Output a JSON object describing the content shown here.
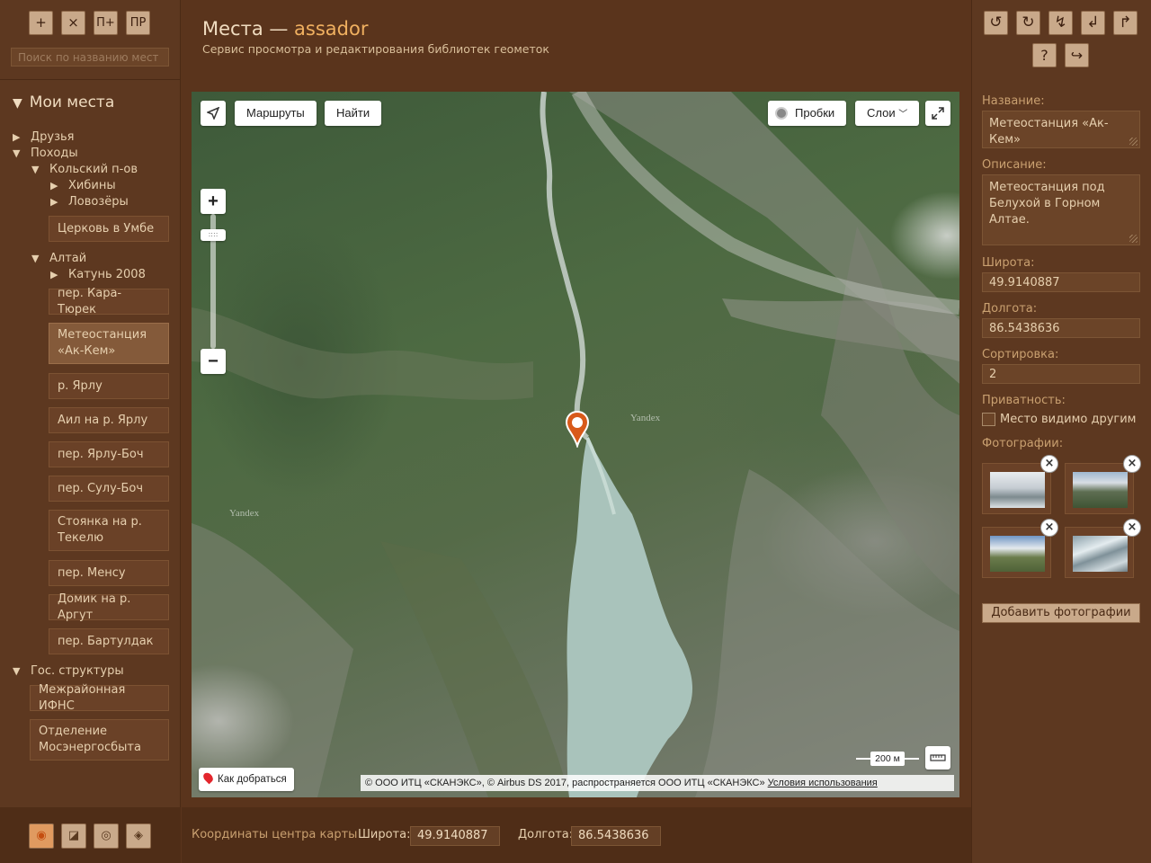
{
  "toolbar_left": {
    "add": "+",
    "delete": "×",
    "add_folder": "П+",
    "rename": "ПР"
  },
  "search": {
    "placeholder": "Поиск по названию мест"
  },
  "tree": {
    "root": "Мои места",
    "friends": "Друзья",
    "hikes": "Походы",
    "kola": "Кольский п-ов",
    "khibiny": "Хибины",
    "lovozero": "Ловозёры",
    "umba_church": "Церковь в Умбе",
    "altai": "Алтай",
    "katun": "Катунь 2008",
    "places": [
      "пер. Кара-Тюрек",
      "Метеостанция «Ак-Кем»",
      "р. Ярлу",
      "Аил на р. Ярлу",
      "пер. Ярлу-Боч",
      "пер. Сулу-Боч",
      "Стоянка на р. Текелю",
      "пер. Менсу",
      "Домик на р. Аргут",
      "пер. Бартулдак"
    ],
    "gov": "Гос. структуры",
    "gov_places": [
      "Межрайонная ИФНС",
      "Отделение Мосэнергосбыта"
    ]
  },
  "modes": [
    "◉",
    "◪",
    "◎",
    "◈"
  ],
  "header": {
    "title": "Места — ",
    "user": "assador",
    "subtitle": "Сервис просмотра и редактирования библиотек геометок"
  },
  "map": {
    "routes": "Маршруты",
    "find": "Найти",
    "traffic": "Пробки",
    "layers": "Слои",
    "yandex": "Yandex",
    "scale": "200 м",
    "route_to": "Как добраться",
    "copyright": "© ООО ИТЦ «СКАНЭКС», © Airbus DS 2017, распространяется ООО ИТЦ «СКАНЭКС»",
    "terms": "Условия использования"
  },
  "bottom": {
    "label": "Координаты центра карты",
    "lat_label": "Широта:",
    "lat": "49.9140887",
    "lng_label": "Долгота:",
    "lng": "86.5438636"
  },
  "toolbar_right": [
    "↺",
    "↻",
    "↯",
    "↲",
    "↱",
    "?",
    "↪"
  ],
  "details": {
    "name_label": "Название:",
    "name": "Метеостанция «Ак-Кем»",
    "desc_label": "Описание:",
    "desc": "Метеостанция под Белухой в Горном Алтае.",
    "lat_label": "Широта:",
    "lat": "49.9140887",
    "lng_label": "Долгота:",
    "lng": "86.5438636",
    "sort_label": "Сортировка:",
    "sort": "2",
    "privacy_label": "Приватность:",
    "privacy_text": "Место видимо другим",
    "privacy_checked": false,
    "photos_label": "Фотографии:",
    "add_photos": "Добавить фотографии"
  }
}
